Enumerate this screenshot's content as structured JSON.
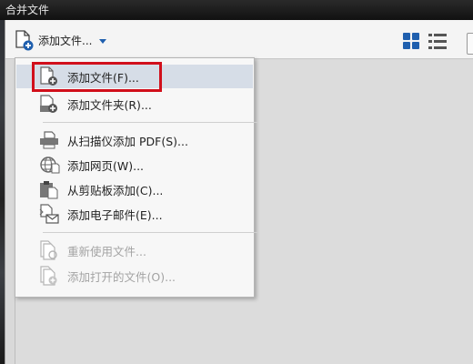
{
  "window": {
    "title": "合并文件"
  },
  "toolbar": {
    "add_files_label": "添加文件...",
    "icons": [
      "add-file-icon",
      "dropdown-caret-icon",
      "thumbnail-view-icon",
      "list-view-icon"
    ]
  },
  "menu": {
    "items": [
      {
        "label": "添加文件(F)...",
        "icon": "add-file-icon",
        "enabled": true,
        "highlighted": true
      },
      {
        "label": "添加文件夹(R)...",
        "icon": "add-folder-icon",
        "enabled": true
      },
      {
        "label": "从扫描仪添加 PDF(S)...",
        "icon": "scanner-icon",
        "enabled": true
      },
      {
        "label": "添加网页(W)...",
        "icon": "web-page-icon",
        "enabled": true
      },
      {
        "label": "从剪贴板添加(C)...",
        "icon": "clipboard-icon",
        "enabled": true
      },
      {
        "label": "添加电子邮件(E)...",
        "icon": "email-icon",
        "enabled": true
      },
      {
        "label": "重新使用文件...",
        "icon": "reuse-files-icon",
        "enabled": false
      },
      {
        "label": "添加打开的文件(O)...",
        "icon": "add-open-files-icon",
        "enabled": false
      }
    ]
  },
  "colors": {
    "accent": "#1f5fae",
    "highlight_border": "#d10f1b",
    "menu_hover": "#d6dde7"
  }
}
